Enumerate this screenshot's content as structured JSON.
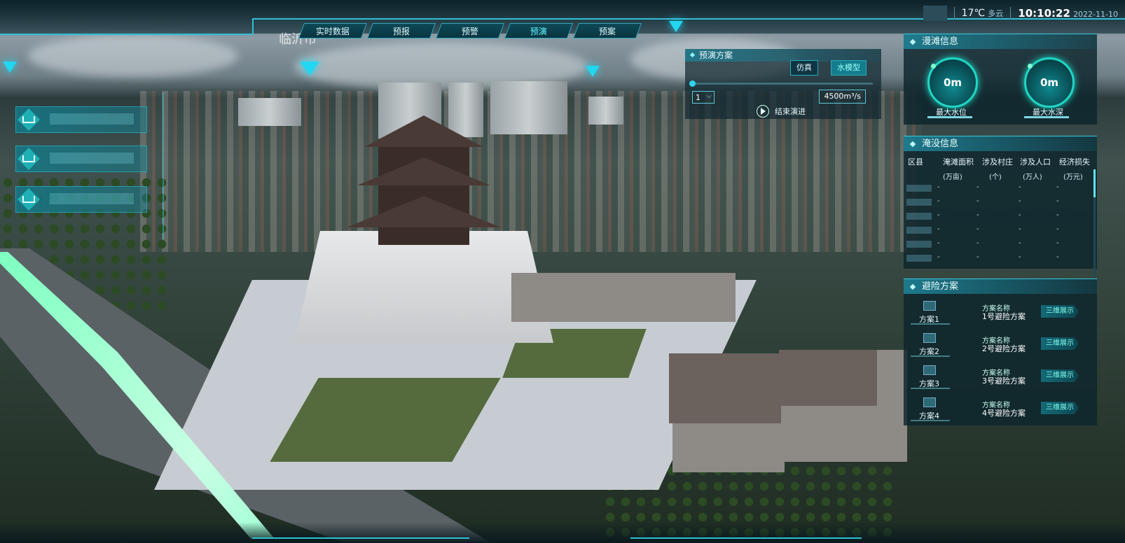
{
  "header": {
    "tabs": [
      {
        "label": "实时数据",
        "active": false
      },
      {
        "label": "预报",
        "active": false
      },
      {
        "label": "预警",
        "active": false
      },
      {
        "label": "预演",
        "active": true
      },
      {
        "label": "预案",
        "active": false
      }
    ],
    "weather": {
      "temperature": "17℃",
      "condition": "多云"
    },
    "time": "10:10:22",
    "date": "2022-11-10",
    "accent_color": "#2fc0d6"
  },
  "scene": {
    "city_label": "临沂市"
  },
  "left_menu": {
    "items": [
      {
        "icon": "layer-icon"
      },
      {
        "icon": "layer-icon"
      },
      {
        "icon": "chart-icon"
      }
    ]
  },
  "simulation": {
    "title": "预演方案",
    "mode_buttons": [
      {
        "label": "仿真",
        "active": false
      },
      {
        "label": "水模型",
        "active": true
      }
    ],
    "selected_value": "1",
    "flow": "4500m³/s",
    "end_label": "结束演进"
  },
  "inundation": {
    "title": "漫滩信息",
    "gauges": [
      {
        "value": "0m",
        "label": "最大水位"
      },
      {
        "value": "0m",
        "label": "最大水深"
      }
    ]
  },
  "flooded": {
    "title": "淹没信息",
    "columns": [
      "区县",
      "淹滩面积",
      "涉及村庄",
      "涉及人口",
      "经济损失"
    ],
    "units": [
      "(万亩)",
      "(个)",
      "(万人)",
      "(万元)"
    ],
    "rows": [
      [
        "-",
        "-",
        "-",
        "-"
      ],
      [
        "-",
        "-",
        "-",
        "-"
      ],
      [
        "-",
        "-",
        "-",
        "-"
      ],
      [
        "-",
        "-",
        "-",
        "-"
      ],
      [
        "-",
        "-",
        "-",
        "-"
      ],
      [
        "-",
        "-",
        "-",
        "-"
      ],
      [
        "-",
        "-",
        "-",
        "-"
      ]
    ]
  },
  "evacuation": {
    "title": "避险方案",
    "plans": [
      {
        "label": "方案1",
        "name_key": "方案名称",
        "name": "1号避险方案",
        "button": "三维展示"
      },
      {
        "label": "方案2",
        "name_key": "方案名称",
        "name": "2号避险方案",
        "button": "三维展示"
      },
      {
        "label": "方案3",
        "name_key": "方案名称",
        "name": "3号避险方案",
        "button": "三维展示"
      },
      {
        "label": "方案4",
        "name_key": "方案名称",
        "name": "4号避险方案",
        "button": "三维展示"
      }
    ]
  }
}
